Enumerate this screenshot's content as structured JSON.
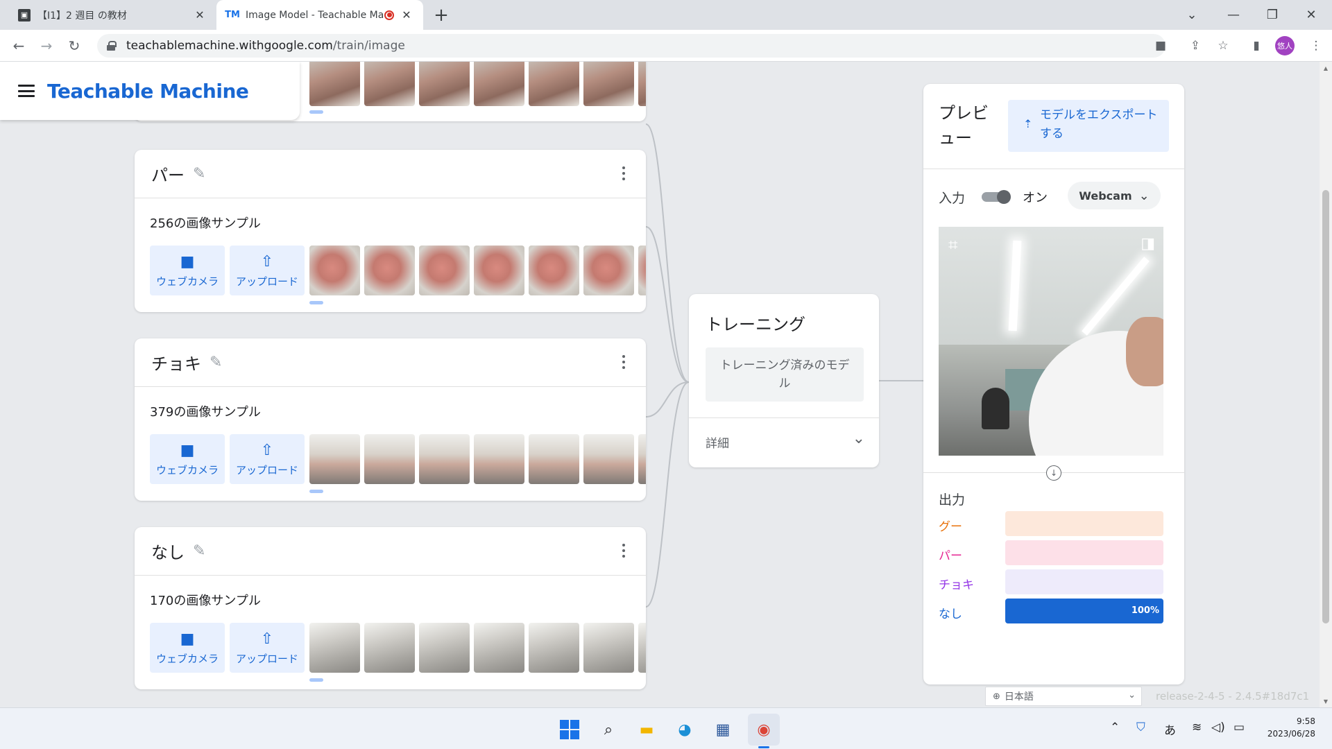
{
  "tabs": [
    {
      "title": "【I1】2 週目 の教材",
      "icon": "classroom-icon"
    },
    {
      "title": "Image Model - Teachable Ma",
      "icon": "teachable-machine-icon",
      "recording": true
    }
  ],
  "address": {
    "domain": "teachablemachine.withgoogle.com",
    "path": "/train/image"
  },
  "profile_initials": "悠人",
  "brand": "Teachable Machine",
  "classes": [
    {
      "name": "パー",
      "samples": "256の画像サンプル",
      "thumb": "pa"
    },
    {
      "name": "チョキ",
      "samples": "379の画像サンプル",
      "thumb": "choki"
    },
    {
      "name": "なし",
      "samples": "170の画像サンプル",
      "thumb": "nashi"
    }
  ],
  "class_actions": {
    "webcam": "ウェブカメラ",
    "upload": "アップロード"
  },
  "training": {
    "title": "トレーニング",
    "button": "トレーニング済みのモデル",
    "details": "詳細"
  },
  "preview": {
    "title": "プレビュー",
    "export": "モデルをエクスポートする",
    "input_label": "入力",
    "input_state": "オン",
    "source": "Webcam",
    "output_label": "出力",
    "outputs": [
      {
        "name": "グー",
        "value": 0,
        "color": "#e8710a",
        "bg": "#fde8db"
      },
      {
        "name": "パー",
        "value": 0,
        "color": "#e52592",
        "bg": "#fde0e8"
      },
      {
        "name": "チョキ",
        "value": 0,
        "color": "#9334e6",
        "bg": "#eeebfb"
      },
      {
        "name": "なし",
        "value": 100,
        "color": "#1967d2",
        "bg": "#d2e3fc",
        "pct": "100%"
      }
    ]
  },
  "footer": {
    "language": "日本語",
    "release": "release-2-4-5 - 2.4.5#18d7c1"
  },
  "taskbar": {
    "time": "9:58",
    "date": "2023/06/28",
    "ime": "あ"
  }
}
